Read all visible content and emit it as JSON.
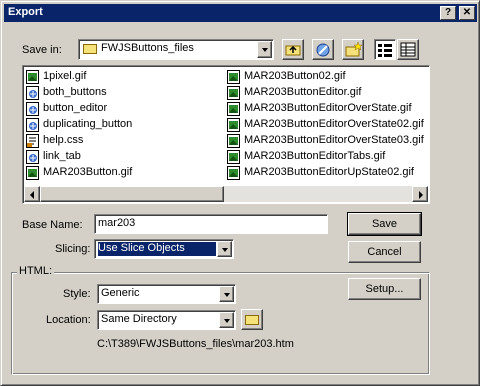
{
  "window": {
    "title": "Export",
    "help_btn": "?",
    "close_btn": "✕"
  },
  "save_in": {
    "label": "Save in:",
    "value": "FWJSButtons_files"
  },
  "toolbar": {
    "up_icon": "folder-up-icon",
    "web_icon": "web-folder-icon",
    "new_folder_icon": "new-folder-icon",
    "list_icon": "list-view-icon",
    "details_icon": "details-view-icon"
  },
  "files": {
    "col1": [
      {
        "name": "1pixel.gif",
        "icon": "gif-file-icon"
      },
      {
        "name": "both_buttons",
        "icon": "html-file-icon"
      },
      {
        "name": "button_editor",
        "icon": "html-file-icon"
      },
      {
        "name": "duplicating_button",
        "icon": "html-file-icon"
      },
      {
        "name": "help.css",
        "icon": "css-file-icon"
      },
      {
        "name": "link_tab",
        "icon": "html-file-icon"
      },
      {
        "name": "MAR203Button.gif",
        "icon": "gif-file-icon"
      }
    ],
    "col2": [
      {
        "name": "MAR203Button02.gif",
        "icon": "gif-file-icon"
      },
      {
        "name": "MAR203ButtonEditor.gif",
        "icon": "gif-file-icon"
      },
      {
        "name": "MAR203ButtonEditorOverState.gif",
        "icon": "gif-file-icon"
      },
      {
        "name": "MAR203ButtonEditorOverState02.gif",
        "icon": "gif-file-icon"
      },
      {
        "name": "MAR203ButtonEditorOverState03.gif",
        "icon": "gif-file-icon"
      },
      {
        "name": "MAR203ButtonEditorTabs.gif",
        "icon": "gif-file-icon"
      },
      {
        "name": "MAR203ButtonEditorUpState02.gif",
        "icon": "gif-file-icon"
      }
    ]
  },
  "base_name": {
    "label": "Base Name:",
    "value": "mar203"
  },
  "slicing": {
    "label": "Slicing:",
    "value": "Use Slice Objects"
  },
  "buttons": {
    "save": "Save",
    "cancel": "Cancel",
    "setup": "Setup..."
  },
  "html_group": {
    "label": "HTML:",
    "style_label": "Style:",
    "style_value": "Generic",
    "location_label": "Location:",
    "location_value": "Same Directory",
    "path": "C:\\T389\\FWJSButtons_files\\mar203.htm"
  },
  "colors": {
    "titlebar": "#0a246a",
    "selection": "#0a246a",
    "face": "#d4d0c8"
  }
}
